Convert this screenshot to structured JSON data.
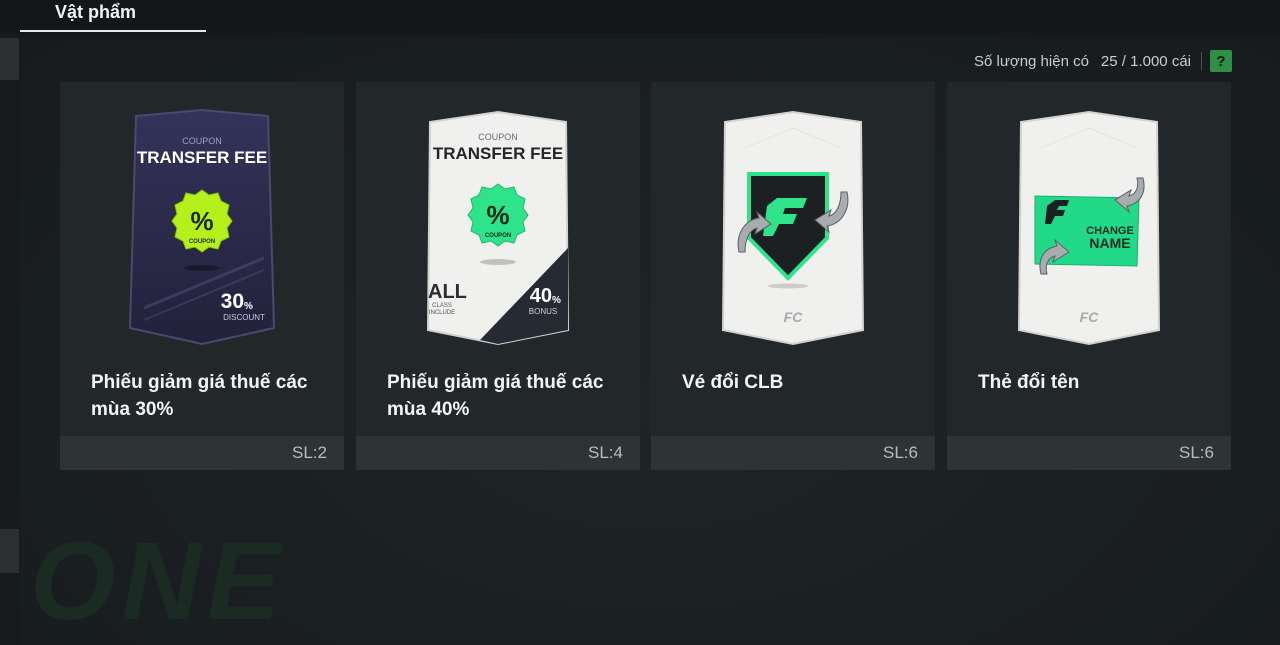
{
  "tab": {
    "label": "Vật phẩm"
  },
  "capacity": {
    "label": "Số lượng hiện có",
    "value": "25 / 1.000 cái",
    "help": "?"
  },
  "items": [
    {
      "name": "Phiếu giảm giá thuế các mùa 30%",
      "qty": "SL:2",
      "art": {
        "kicker": "COUPON",
        "heading": "TRANSFER FEE",
        "badge": "%",
        "badge_sub": "COUPON",
        "pct": "30",
        "pct_unit": "%",
        "pct_label": "DISCOUNT"
      }
    },
    {
      "name": "Phiếu giảm giá thuế các mùa 40%",
      "qty": "SL:4",
      "art": {
        "kicker": "COUPON",
        "heading": "TRANSFER FEE",
        "badge": "%",
        "badge_sub": "COUPON",
        "all": "ALL",
        "all_sub1": "CLASS",
        "all_sub2": "INCLUDE",
        "pct": "40",
        "pct_unit": "%",
        "pct_label": "BONUS"
      }
    },
    {
      "name": "Vé đổi CLB",
      "qty": "SL:6",
      "art": {
        "logo": "FC"
      }
    },
    {
      "name": "Thẻ đổi tên",
      "qty": "SL:6",
      "art": {
        "logo": "FC",
        "line1": "CHANGE",
        "line2": "NAME"
      }
    }
  ],
  "colors": {
    "accent_green": "#2fe38a",
    "coupon_purple": "#2e2c4a",
    "help_green": "#2f8f46"
  }
}
